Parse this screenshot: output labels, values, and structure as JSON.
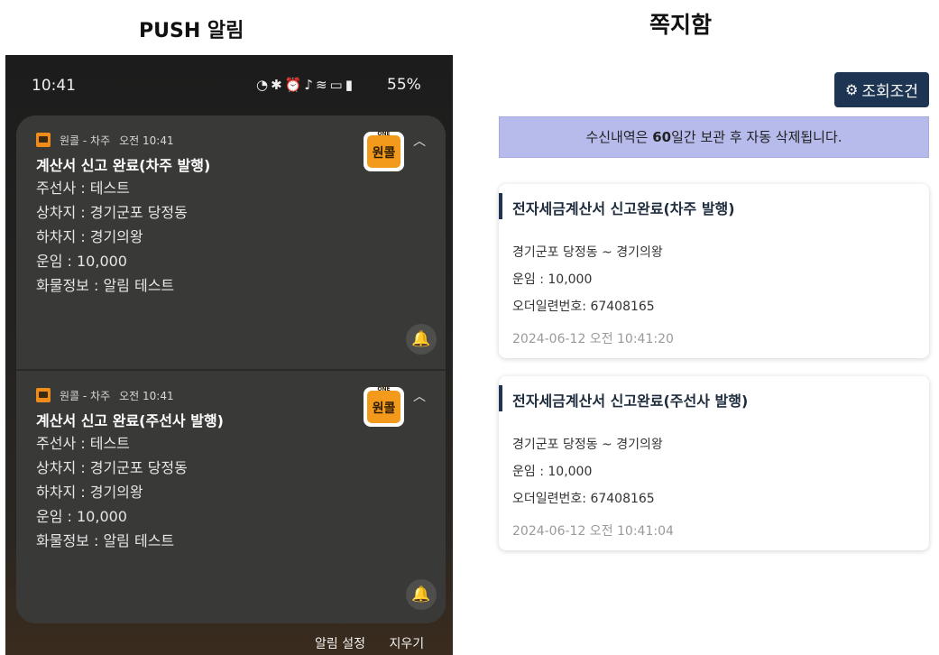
{
  "headers": {
    "push": "PUSH 알림",
    "inbox": "쪽지함"
  },
  "status_bar": {
    "time": "10:41",
    "battery": "55%"
  },
  "notifications": [
    {
      "app": "원콜 - 차주",
      "time": "오전 10:41",
      "title": "계산서 신고 완료(차주 발행)",
      "lines": [
        "주선사 : 테스트",
        "상차지 : 경기군포 당정동",
        "하차지 : 경기의왕",
        "운임 : 10,000",
        "화물정보 : 알림 테스트"
      ]
    },
    {
      "app": "원콜 - 차주",
      "time": "오전 10:41",
      "title": "계산서 신고 완료(주선사 발행)",
      "lines": [
        "주선사 : 테스트",
        "상차지 : 경기군포 당정동",
        "하차지 : 경기의왕",
        "운임 : 10,000",
        "화물정보 : 알림 테스트"
      ]
    }
  ],
  "app_icon": {
    "small_text": "ONE",
    "text": "원콜"
  },
  "bottom_actions": {
    "settings": "알림 설정",
    "clear": "지우기"
  },
  "inbox": {
    "filter_button": "조회조건",
    "notice_pre": "수신내역은 ",
    "notice_bold": "60",
    "notice_post": "일간 보관 후 자동 삭제됩니다.",
    "messages": [
      {
        "title": "전자세금계산서 신고완료(차주 발행)",
        "route": "경기군포 당정동 ~ 경기의왕",
        "fare": "운임 : 10,000",
        "order": "오더일련번호: 67408165",
        "date": "2024-06-12 오전 10:41:20"
      },
      {
        "title": "전자세금계산서 신고완료(주선사 발행)",
        "route": "경기군포 당정동 ~ 경기의왕",
        "fare": "운임 : 10,000",
        "order": "오더일련번호: 67408165",
        "date": "2024-06-12 오전 10:41:04"
      }
    ]
  },
  "colors": {
    "navy": "#1d3553",
    "notice_bg": "#b6bbec",
    "app_orange": "#f39a1c"
  },
  "icons": [
    "timer-icon",
    "bluetooth-icon",
    "alarm-icon",
    "mute-icon",
    "wifi-icon",
    "hd-icon",
    "signal-icon",
    "battery-icon",
    "bell-icon",
    "chevron-up-icon",
    "gear-icon"
  ]
}
